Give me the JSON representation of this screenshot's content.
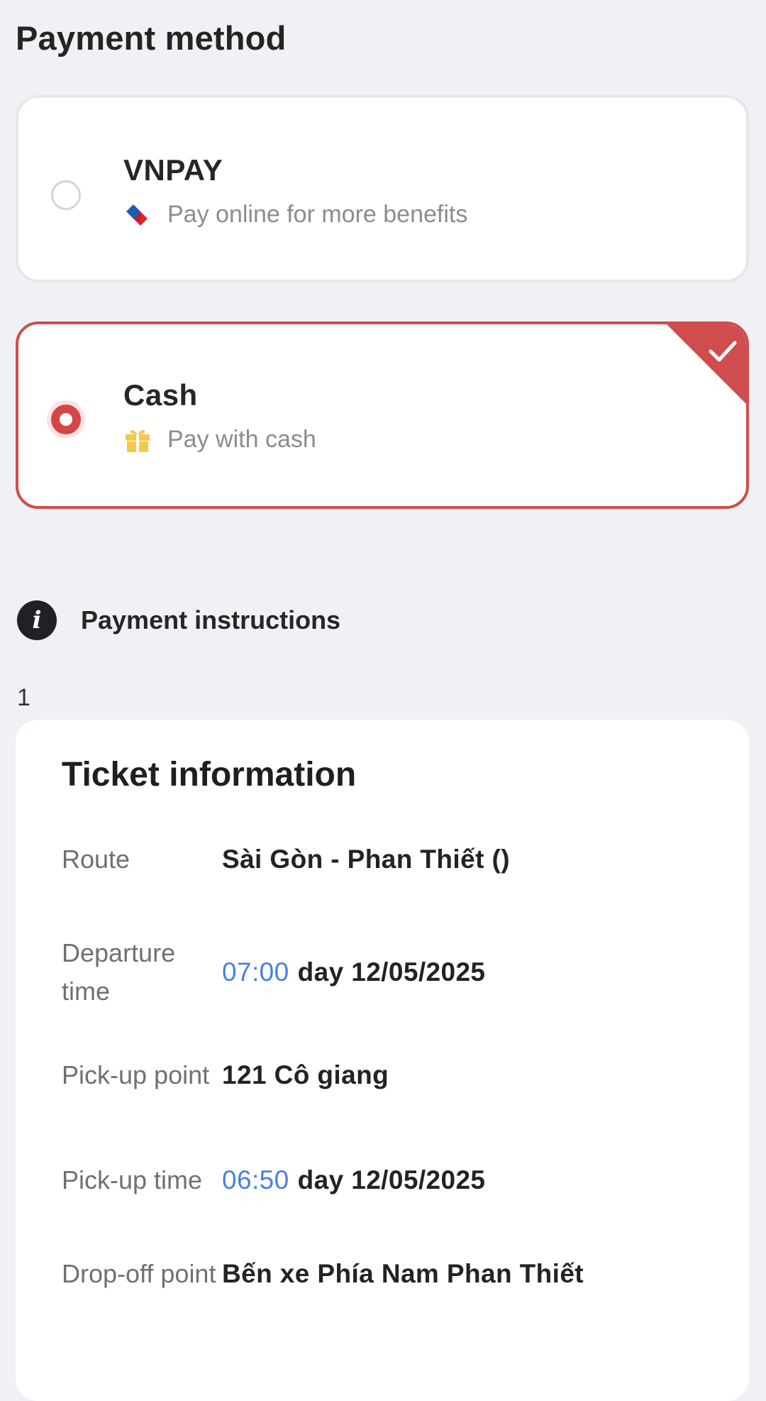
{
  "payment": {
    "title": "Payment method",
    "methods": [
      {
        "name": "VNPAY",
        "description": "Pay online for more benefits",
        "selected": false,
        "icon": "vnpay-logo-icon"
      },
      {
        "name": "Cash",
        "description": "Pay with cash",
        "selected": true,
        "icon": "gift-icon"
      }
    ],
    "instructions_label": "Payment instructions",
    "stray_number": "1"
  },
  "ticket": {
    "title": "Ticket information",
    "rows": [
      {
        "label": "Route",
        "value": "Sài Gòn - Phan Thiết ()"
      },
      {
        "label": "Departure time",
        "time": "07:00",
        "value": "day 12/05/2025"
      },
      {
        "label": "Pick-up point",
        "value": "121 Cô giang"
      },
      {
        "label": "Pick-up time",
        "time": "06:50",
        "value": "day 12/05/2025"
      },
      {
        "label": "Drop-off point",
        "value": "Bến xe Phía Nam Phan Thiết"
      }
    ]
  },
  "colors": {
    "accent": "#d64545",
    "time_blue": "#4a7fde",
    "background": "#f0f1f5"
  }
}
